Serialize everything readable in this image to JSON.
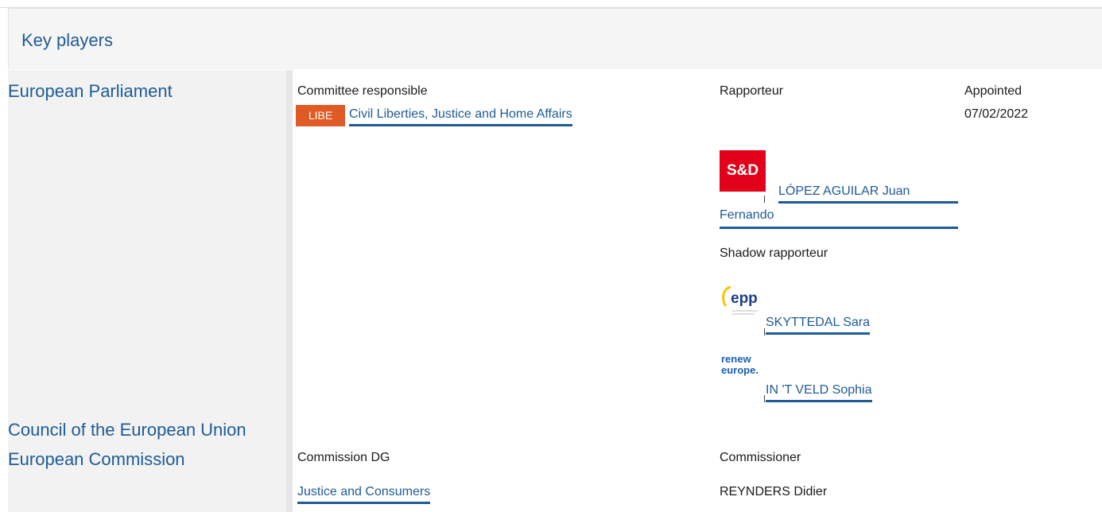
{
  "section": {
    "title": "Key players"
  },
  "institutions": {
    "parliament": "European Parliament",
    "council": "Council of the European Union",
    "commission": "European Commission"
  },
  "parliament": {
    "committee_header": "Committee responsible",
    "rapporteur_header": "Rapporteur",
    "appointed_header": "Appointed",
    "committee_code": "LIBE",
    "committee_name": "Civil Liberties, Justice and Home Affairs",
    "appointed_date": "07/02/2022",
    "rapporteur": {
      "group_logo": "S&D",
      "name_line1": "LÓPEZ AGUILAR Juan",
      "name_line2": "Fernando"
    },
    "shadow_header": "Shadow rapporteur",
    "shadows": [
      {
        "group_logo": "epp",
        "name": "SKYTTEDAL Sara"
      },
      {
        "group_logo_line1": "renew",
        "group_logo_line2": "europe.",
        "name": "IN 'T VELD Sophia"
      }
    ]
  },
  "commission": {
    "dg_header": "Commission DG",
    "commissioner_header": "Commissioner",
    "dg_name": "Justice and Consumers",
    "commissioner_name": "REYNDERS Didier"
  },
  "colors": {
    "link": "#1f5b95",
    "badge": "#e05a26",
    "sd_red": "#e2001a",
    "epp_blue": "#1a3e8c",
    "epp_yellow": "#f7c600",
    "renew_blue": "#1a5fb4"
  }
}
